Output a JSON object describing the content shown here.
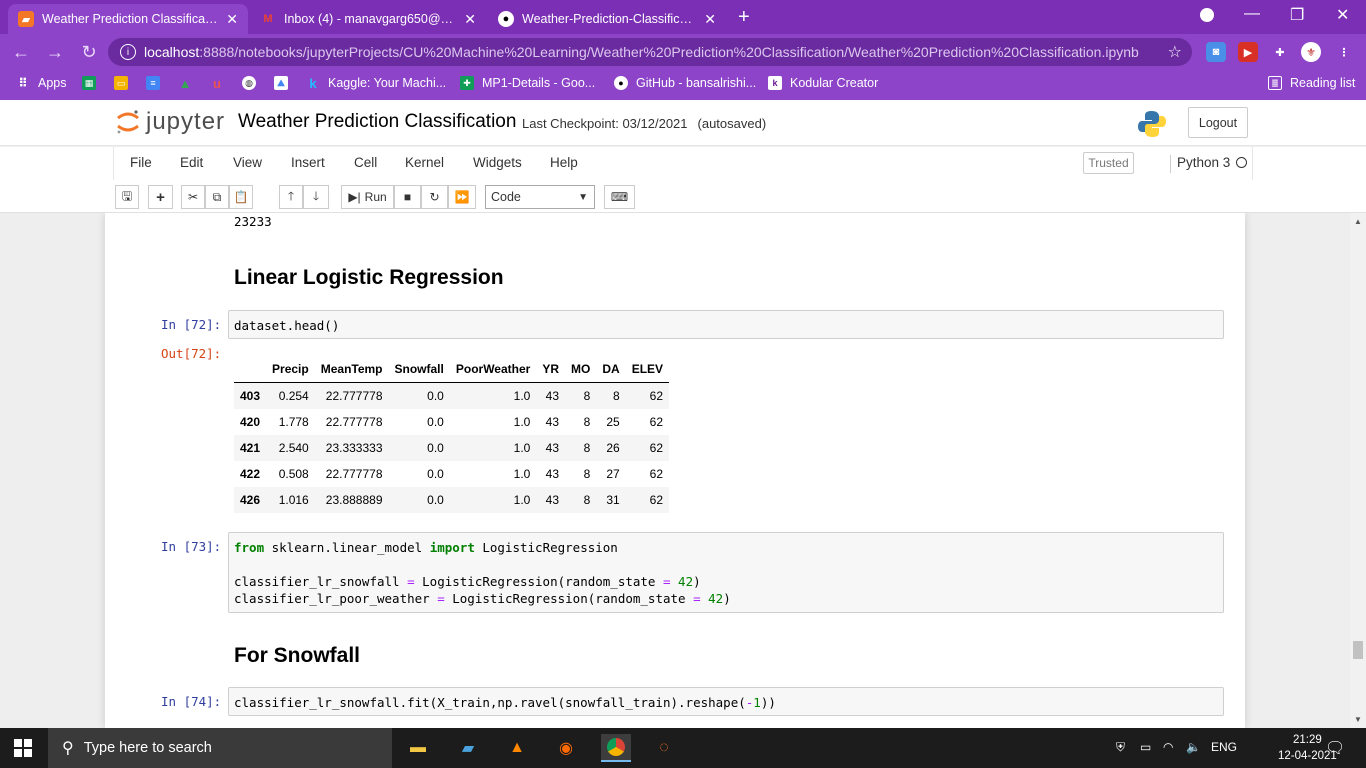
{
  "browser": {
    "tabs": [
      {
        "title": "Weather Prediction Classification",
        "favicon": "jupyter-favicon",
        "active": true
      },
      {
        "title": "Inbox (4) - manavgarg650@gmail",
        "favicon": "gmail-icon",
        "active": false
      },
      {
        "title": "Weather-Prediction-Classification",
        "favicon": "github-icon",
        "active": false
      }
    ],
    "new_tab": "+",
    "url_host": "localhost",
    "url_path": ":8888/notebooks/jupyterProjects/CU%20Machine%20Learning/Weather%20Prediction%20Classification/Weather%20Prediction%20Classification.ipynb",
    "bookmarks": [
      {
        "label": "Apps",
        "icon": "apps-grid-icon"
      },
      {
        "label": "",
        "icon": "sheets-icon"
      },
      {
        "label": "",
        "icon": "slides-icon"
      },
      {
        "label": "",
        "icon": "docs-icon"
      },
      {
        "label": "",
        "icon": "drive-icon"
      },
      {
        "label": "",
        "icon": "udemy-icon"
      },
      {
        "label": "",
        "icon": "globe-icon"
      },
      {
        "label": "",
        "icon": "photos-icon"
      },
      {
        "label": "Kaggle: Your Machi...",
        "icon": "kaggle-icon"
      },
      {
        "label": "MP1-Details - Goo...",
        "icon": "sheets-icon"
      },
      {
        "label": "GitHub - bansalrishi...",
        "icon": "github-icon"
      },
      {
        "label": "Kodular Creator",
        "icon": "kodular-icon"
      }
    ],
    "reading_list": "Reading list",
    "accent_color": "#8e44c9"
  },
  "jupyter": {
    "logo_text": "jupyter",
    "notebook_name": "Weather Prediction Classification",
    "checkpoint": "Last Checkpoint: 03/12/2021",
    "autosaved": "(autosaved)",
    "logout": "Logout",
    "menu": [
      "File",
      "Edit",
      "View",
      "Insert",
      "Cell",
      "Kernel",
      "Widgets",
      "Help"
    ],
    "trusted": "Trusted",
    "kernel": "Python 3",
    "run_label": "Run",
    "cell_type": "Code"
  },
  "notebook": {
    "prev_output": "23233",
    "heading1": "Linear Logistic Regression",
    "cell72_in": "In [72]:",
    "cell72_out": "Out[72]:",
    "cell72_code": "dataset.head()",
    "table": {
      "columns": [
        "",
        "Precip",
        "MeanTemp",
        "Snowfall",
        "PoorWeather",
        "YR",
        "MO",
        "DA",
        "ELEV"
      ],
      "rows": [
        [
          "403",
          "0.254",
          "22.777778",
          "0.0",
          "1.0",
          "43",
          "8",
          "8",
          "62"
        ],
        [
          "420",
          "1.778",
          "22.777778",
          "0.0",
          "1.0",
          "43",
          "8",
          "25",
          "62"
        ],
        [
          "421",
          "2.540",
          "23.333333",
          "0.0",
          "1.0",
          "43",
          "8",
          "26",
          "62"
        ],
        [
          "422",
          "0.508",
          "22.777778",
          "0.0",
          "1.0",
          "43",
          "8",
          "27",
          "62"
        ],
        [
          "426",
          "1.016",
          "23.888889",
          "0.0",
          "1.0",
          "43",
          "8",
          "31",
          "62"
        ]
      ]
    },
    "cell73_in": "In [73]:",
    "cell73_line1": {
      "kw1": "from",
      "mod": " sklearn.linear_model ",
      "kw2": "import",
      "name": " LogisticRegression"
    },
    "cell73_line2": {
      "lhs": "classifier_lr_snowfall ",
      "eq": "=",
      "call": " LogisticRegression(random_state ",
      "eq2": "=",
      "sp": " ",
      "num": "42",
      "end": ")"
    },
    "cell73_line3": {
      "lhs": "classifier_lr_poor_weather ",
      "eq": "=",
      "call": " LogisticRegression(random_state ",
      "eq2": "=",
      "sp": " ",
      "num": "42",
      "end": ")"
    },
    "heading2": "For Snowfall",
    "cell74_in": "In [74]:",
    "cell74_code": {
      "pre": "classifier_lr_snowfall.fit(X_train,np.ravel(snowfall_train).reshape(",
      "op": "-",
      "num": "1",
      "end": "))"
    }
  },
  "taskbar": {
    "search_placeholder": "Type here to search",
    "lang": "ENG",
    "time": "21:29",
    "date": "12-04-2021"
  }
}
